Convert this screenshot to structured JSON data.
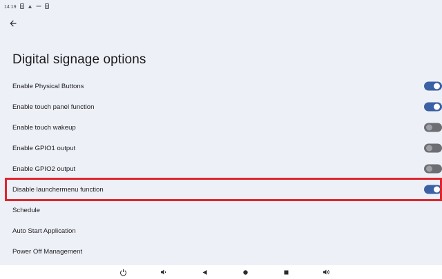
{
  "status_bar": {
    "time": "14:19",
    "icons": [
      "notification-icon",
      "signal-icon",
      "minus-icon",
      "notification-icon"
    ]
  },
  "header": {
    "back_icon": "arrow-left-icon",
    "title": "Digital signage options"
  },
  "settings": [
    {
      "label": "Enable Physical Buttons",
      "toggle": "on"
    },
    {
      "label": "Enable touch panel function",
      "toggle": "on"
    },
    {
      "label": "Enable touch wakeup",
      "toggle": "off"
    },
    {
      "label": "Enable GPIO1 output",
      "toggle": "off"
    },
    {
      "label": "Enable GPIO2 output",
      "toggle": "off"
    },
    {
      "label": "Disable launchermenu function",
      "toggle": "on",
      "highlighted": true
    },
    {
      "label": "Schedule"
    },
    {
      "label": "Auto Start Application"
    },
    {
      "label": "Power Off Management"
    }
  ],
  "nav_bar": {
    "buttons": [
      "power-icon",
      "volume-down-icon",
      "back-triangle-icon",
      "home-circle-icon",
      "recents-square-icon",
      "volume-up-icon"
    ]
  },
  "colors": {
    "background": "#eef0f7",
    "toggle_on": "#3b60a4",
    "toggle_off": "#6c6e74",
    "highlight_border": "#e0252e"
  }
}
